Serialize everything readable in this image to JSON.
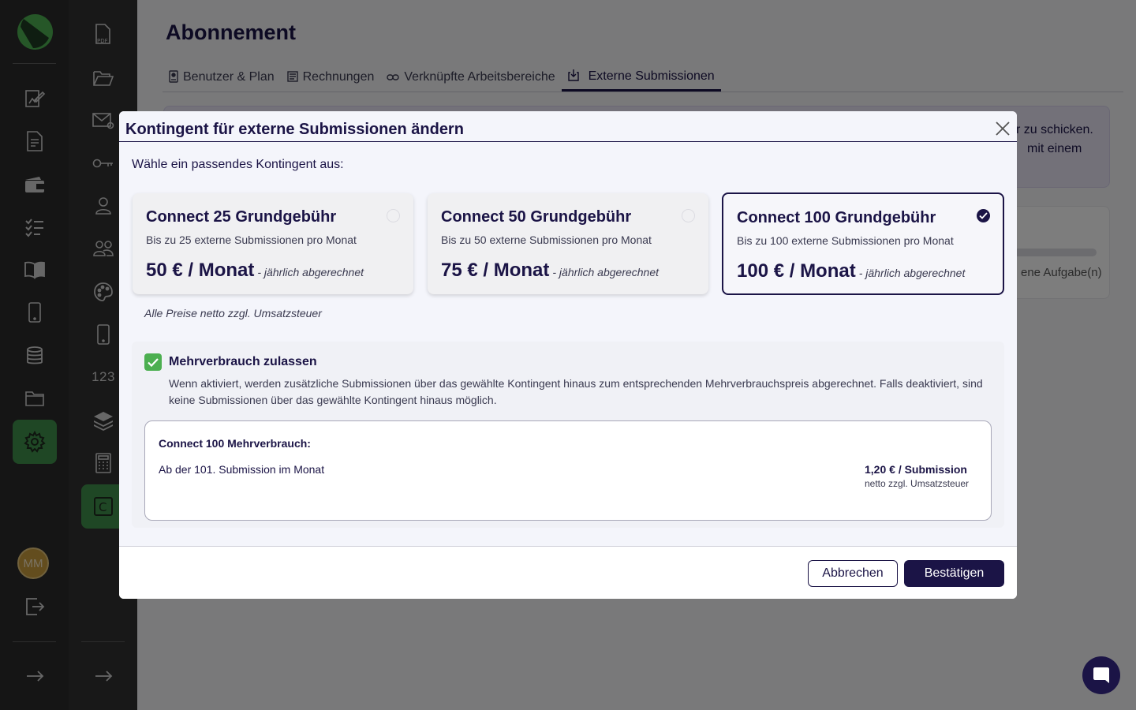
{
  "colors": {
    "brand": "#1b1446",
    "accent_green": "#4caf50",
    "rail_dark": "#2b2b2b"
  },
  "rail_primary": {
    "icons": [
      "logo-icon",
      "edit-document-icon",
      "document-icon",
      "wallet-icon",
      "checklist-icon",
      "book-icon",
      "phone-icon",
      "database-icon",
      "folder-icon",
      "settings-icon",
      "arrow-right-icon"
    ],
    "avatar_initials": "MM"
  },
  "rail_secondary": {
    "icons": [
      "pdf-file-icon",
      "folder-open-icon",
      "mail-at-icon",
      "key-icon",
      "user-icon",
      "users-icon",
      "palette-icon",
      "mobile-icon",
      "number-icon",
      "layers-icon",
      "calculator-icon",
      "connect-icon",
      "arrow-right-icon"
    ],
    "number_label": "123",
    "connect_label": "C"
  },
  "page": {
    "title": "Abonnement",
    "tabs": [
      {
        "label": "Benutzer & Plan",
        "icon": "badge-icon"
      },
      {
        "label": "Rechnungen",
        "icon": "invoice-icon"
      },
      {
        "label": "Verknüpfte Arbeitsbereiche",
        "icon": "link-icon"
      },
      {
        "label": "Externe Submissionen",
        "icon": "inbox-icon",
        "active": true
      }
    ],
    "bg_card_text_line1": "r zu schicken.",
    "bg_card_text_line2": "mit einem",
    "bg_card2_text": "ene Aufgabe(n)"
  },
  "modal": {
    "title": "Kontingent für externe Submissionen ändern",
    "subtitle": "Wähle ein passendes Kontingent aus:",
    "plans": [
      {
        "title": "Connect 25 Grundgebühr",
        "desc": "Bis zu 25 externe Submissionen pro Monat",
        "price": "50 € / Monat",
        "billing": "- jährlich abgerechnet",
        "selected": false
      },
      {
        "title": "Connect 50 Grundgebühr",
        "desc": "Bis zu 50 externe Submissionen pro Monat",
        "price": "75 € / Monat",
        "billing": "- jährlich abgerechnet",
        "selected": false
      },
      {
        "title": "Connect 100 Grundgebühr",
        "desc": "Bis zu 100 externe Submissionen pro Monat",
        "price": "100 € / Monat",
        "billing": "- jährlich abgerechnet",
        "selected": true
      }
    ],
    "net_note": "Alle Preise netto zzgl. Umsatzsteuer",
    "overuse": {
      "checked": true,
      "label": "Mehrverbrauch zulassen",
      "desc": "Wenn aktiviert, werden zusätzliche Submissionen über das gewählte Kontingent hinaus zum entsprechenden Mehrverbrauchspreis abgerechnet. Falls deaktiviert, sind keine Submissionen über das gewählte Kontingent hinaus möglich.",
      "detail_title": "Connect 100 Mehrverbrauch:",
      "detail_from": "Ab der 101. Submission im Monat",
      "detail_price": "1,20 € / Submission",
      "detail_net": "netto zzgl. Umsatzsteuer"
    },
    "cancel_label": "Abbrechen",
    "confirm_label": "Bestätigen"
  }
}
